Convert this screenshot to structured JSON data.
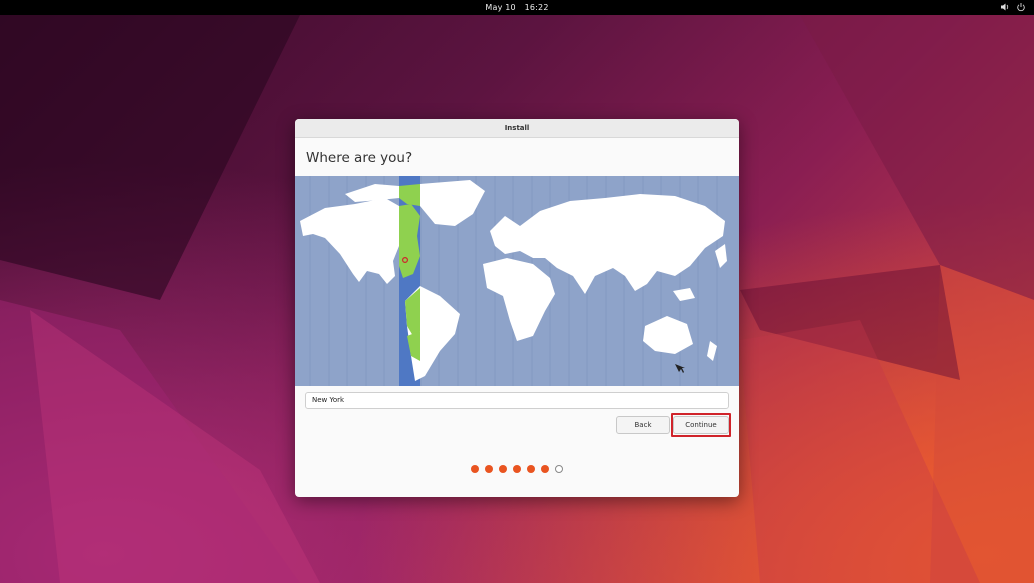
{
  "topbar": {
    "date": "May 10",
    "time": "16:22",
    "icons": [
      "volume-icon",
      "power-icon"
    ]
  },
  "window": {
    "title": "Install",
    "heading": "Where are you?",
    "location_value": "New York",
    "back_label": "Back",
    "continue_label": "Continue",
    "progress": {
      "total": 7,
      "completed": 6
    }
  },
  "colors": {
    "accent": "#e95420",
    "map_ocean": "#8ea3c9",
    "timezone_band": "#4f78c4",
    "timezone_land": "#8fd14f",
    "highlight_border": "#d0232a"
  }
}
